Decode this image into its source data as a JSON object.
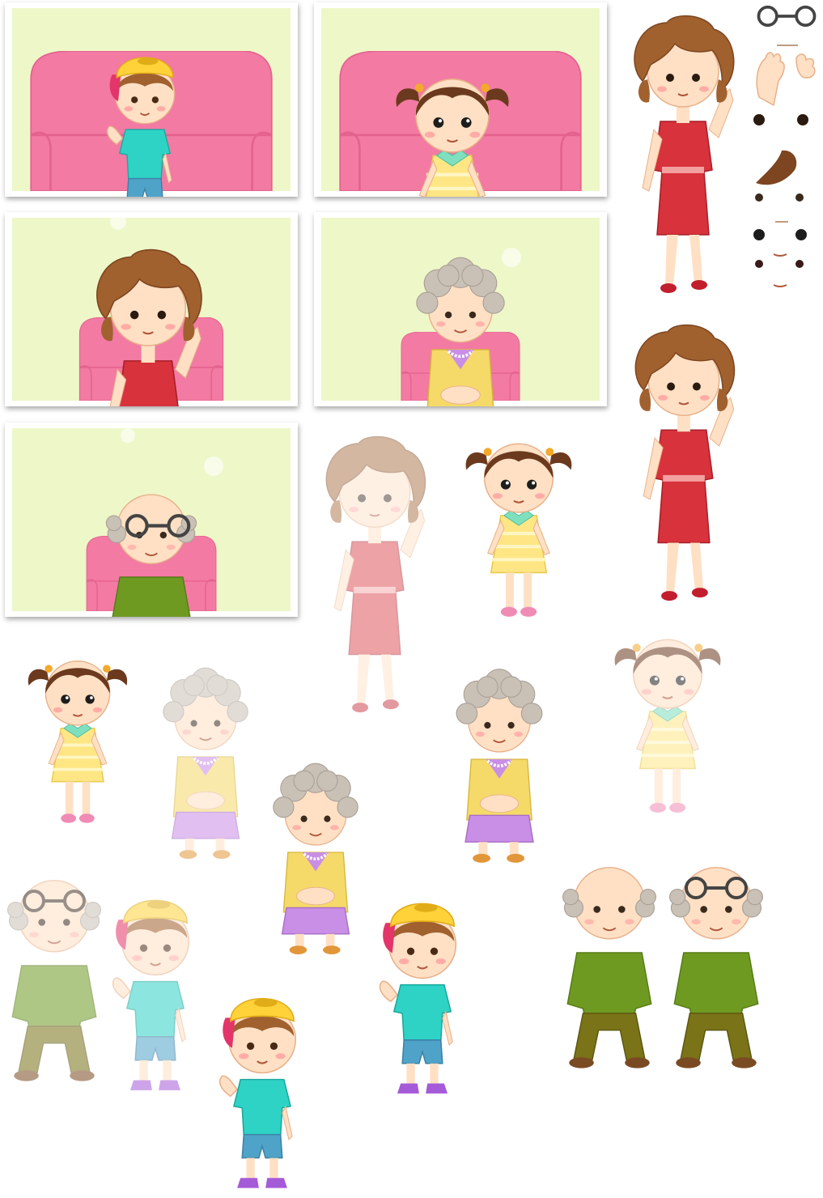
{
  "sheet": {
    "kind": "character-sprite-atlas",
    "colors": {
      "card_background": "#eef7c8",
      "sofa": "#f27aa3",
      "sofa_shadow": "#e4628e",
      "skin": "#ffe0c4",
      "cheek": "#ff9f9f",
      "brown_hair": "#a0612e",
      "dark_hair": "#6b3a1e",
      "gray_hair": "#c9c0b6",
      "boy_cap": "#ffd23a",
      "boy_cap_back": "#e3356a",
      "boy_shirt": "#2fd3c6",
      "boy_shorts": "#4fa3c9",
      "girl_dress": "#ffe684",
      "girl_collar": "#7fe0c0",
      "mom_dress": "#d8323c",
      "grandma_cardigan": "#f5da6a",
      "grandma_skirt": "#c98ee6",
      "grandpa_sweater": "#6f9a22",
      "grandpa_pants": "#7a7318",
      "glasses": "#444444",
      "shoes_red": "#c21e2e",
      "shoes_purple": "#a55ad8",
      "shoes_pink": "#f08bb5",
      "shoes_brown": "#7a4b22"
    },
    "cards": [
      {
        "character": "boy",
        "pose": "waving"
      },
      {
        "character": "girl",
        "pose": "portrait"
      },
      {
        "character": "mom",
        "pose": "waving"
      },
      {
        "character": "grandma",
        "pose": "portrait"
      },
      {
        "character": "grandpa",
        "pose": "portrait"
      }
    ],
    "parts": [
      "glasses",
      "hand-waving",
      "hand-open",
      "eyes-open",
      "hair-tuft",
      "eyes-small",
      "eyes-round",
      "eyes-closed",
      "mouth-smile"
    ],
    "sprites": [
      {
        "character": "mom",
        "pose": "standing",
        "opacity": 1
      },
      {
        "character": "mom",
        "pose": "waving",
        "opacity": 1
      },
      {
        "character": "mom",
        "pose": "waving",
        "opacity": 0.55
      },
      {
        "character": "girl",
        "pose": "standing",
        "opacity": 1
      },
      {
        "character": "girl",
        "pose": "standing-eyes-closed",
        "opacity": 1
      },
      {
        "character": "girl",
        "pose": "standing",
        "opacity": 0.55
      },
      {
        "character": "grandma",
        "pose": "sitting",
        "opacity": 0.55
      },
      {
        "character": "grandma",
        "pose": "sitting",
        "opacity": 1
      },
      {
        "character": "grandma",
        "pose": "sitting-eyes-closed",
        "opacity": 1
      },
      {
        "character": "grandpa",
        "pose": "sitting",
        "opacity": 0.55
      },
      {
        "character": "grandpa",
        "pose": "sitting-eyes-closed",
        "opacity": 1
      },
      {
        "character": "grandpa",
        "pose": "sitting-glasses",
        "opacity": 1
      },
      {
        "character": "boy",
        "pose": "waving",
        "opacity": 0.55
      },
      {
        "character": "boy",
        "pose": "waving",
        "opacity": 1
      },
      {
        "character": "boy",
        "pose": "standing-eyes-closed",
        "opacity": 1
      }
    ]
  }
}
